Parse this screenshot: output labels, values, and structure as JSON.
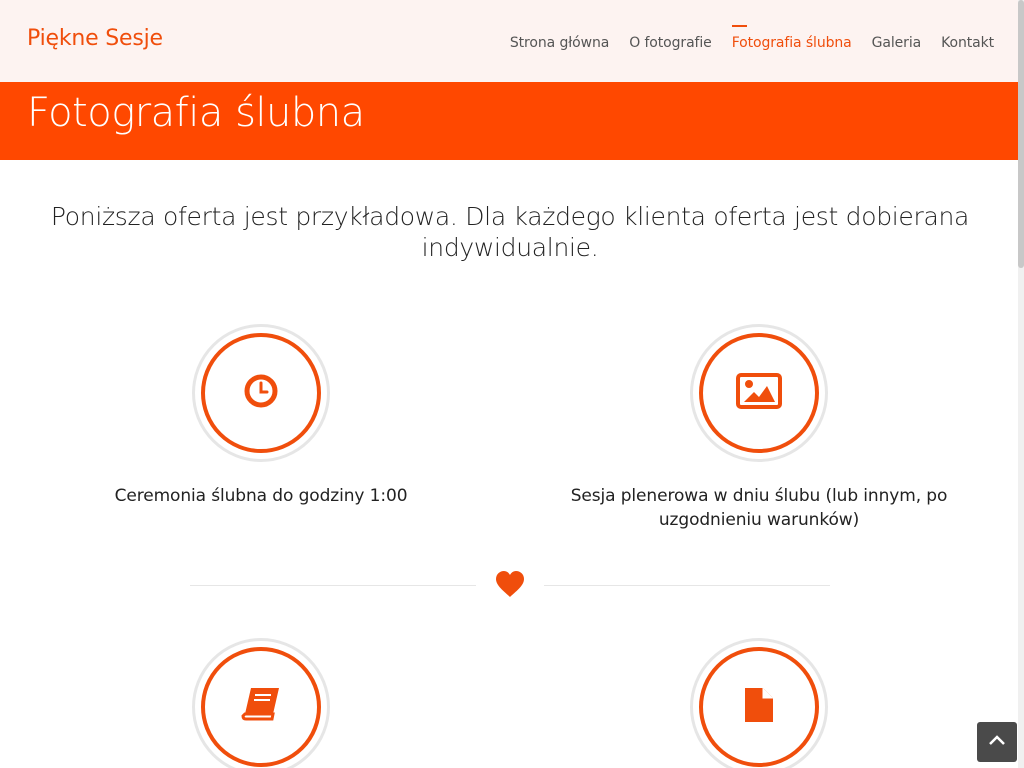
{
  "brand": "Piękne Sesje",
  "nav": [
    {
      "label": "Strona główna"
    },
    {
      "label": "O fotografie"
    },
    {
      "label": "Fotografia ślubna"
    },
    {
      "label": "Galeria"
    },
    {
      "label": "Kontakt"
    }
  ],
  "active_nav": "Fotografia ślubna",
  "hero": {
    "title": "Fotografia ślubna"
  },
  "lead": "Poniższa oferta jest przykładowa. Dla każdego klienta oferta jest dobierana indywidualnie.",
  "features": [
    {
      "icon": "clock-icon",
      "text": "Ceremonia ślubna do godziny 1:00"
    },
    {
      "icon": "image-icon",
      "text": "Sesja plenerowa w dniu ślubu (lub innym, po uzgodnieniu warunków)"
    },
    {
      "icon": "book-icon",
      "text": ""
    },
    {
      "icon": "file-icon",
      "text": ""
    }
  ],
  "divider_icon": "heart-icon",
  "scroll_to_top_icon": "chevron-up-icon",
  "colors": {
    "accent": "#f04e0c",
    "hero_bg": "#ff4800",
    "topbar_bg": "#fdf3f1",
    "circle_ring": "#e6e6e6",
    "to_top_bg": "#4a4a4a"
  }
}
